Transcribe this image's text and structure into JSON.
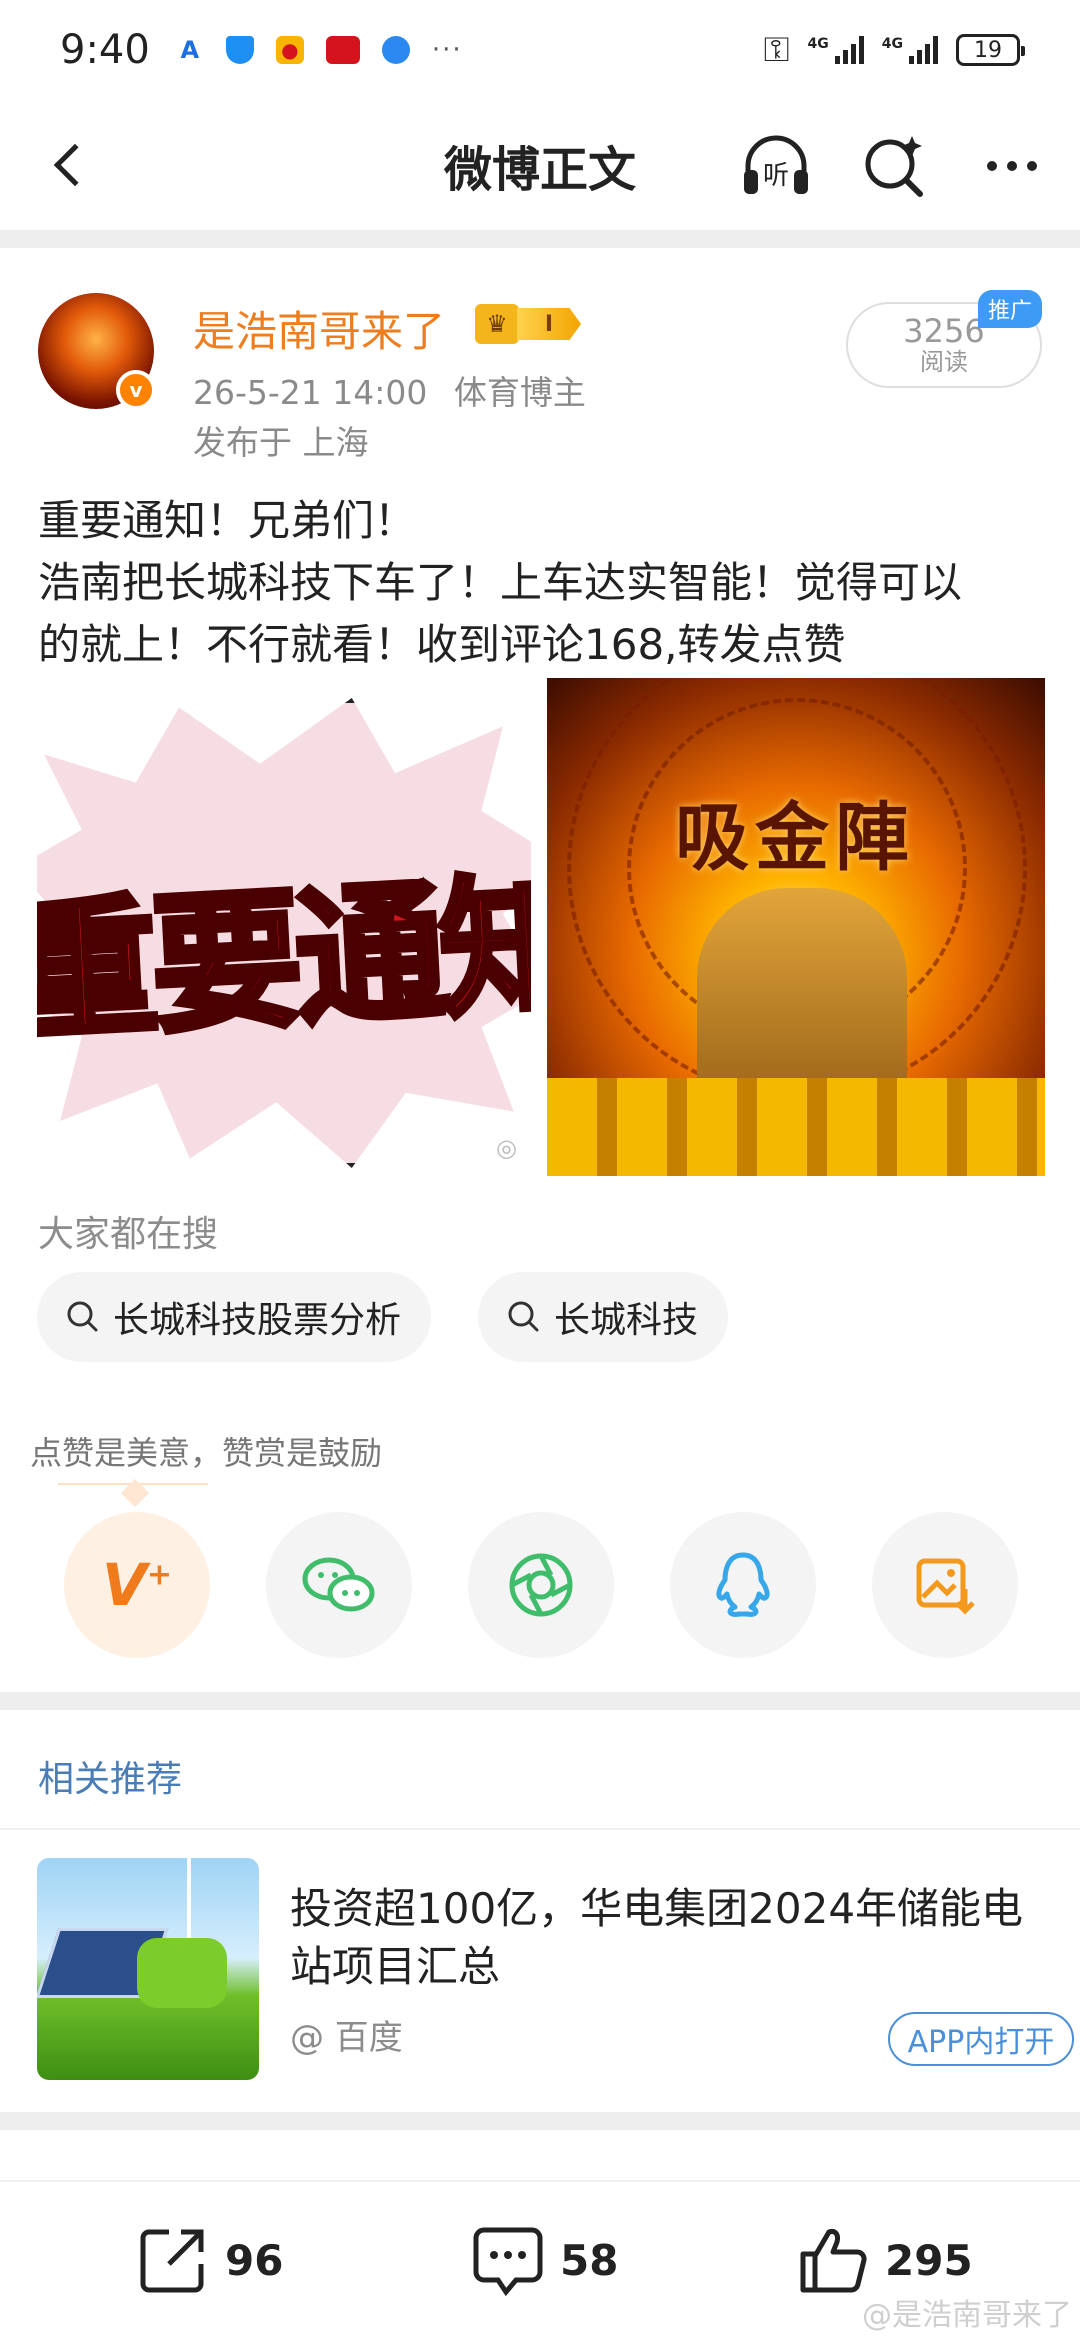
{
  "status_bar": {
    "time": "9:40",
    "notification_icons": [
      "A",
      "shield-icon",
      "weibo-icon",
      "news-icon",
      "globe-icon"
    ],
    "more": "···",
    "network_1": "4G",
    "network_2": "4G",
    "battery": "19"
  },
  "nav": {
    "title": "微博正文",
    "listen_label": "听"
  },
  "post": {
    "author": "是浩南哥来了",
    "vip_level": "I",
    "verified_mark": "v",
    "time": "26-5-21 14:00",
    "role": "体育博主",
    "location": "发布于 上海",
    "reads": "3256",
    "reads_label": "阅读",
    "promo_tag": "推广",
    "text_lines": [
      "重要通知！兄弟们！",
      "浩南把长城科技下车了！上车达实智能！觉得可以",
      "的就上！不行就看！收到评论168,转发点赞"
    ],
    "image_left_text": "重要通知",
    "image_right_text": "吸金陣"
  },
  "search": {
    "hint": "大家都在搜",
    "chips": [
      "长城科技股票分析",
      "长城科技"
    ]
  },
  "reward": {
    "hint": "点赞是美意，赞赏是鼓励",
    "reward_icon_label": "V",
    "share_targets": [
      "reward-icon",
      "wechat-icon",
      "moments-icon",
      "qq-icon",
      "save-image-icon"
    ]
  },
  "related": {
    "title": "相关推荐",
    "headline": "投资超100亿，华电集团2024年储能电站项目汇总",
    "source": "@ 百度",
    "open_button": "APP内打开"
  },
  "bottom_bar": {
    "repost_count": "96",
    "comment_count": "58",
    "like_count": "295",
    "watermark": "@是浩南哥来了"
  },
  "colors": {
    "accent_orange": "#ee7d1e",
    "link_blue": "#4a7db6",
    "promo_blue": "#3d9bf5",
    "wechat_green": "#3fbd6a",
    "qq_blue": "#36a7e8",
    "save_orange": "#f39a1e"
  }
}
